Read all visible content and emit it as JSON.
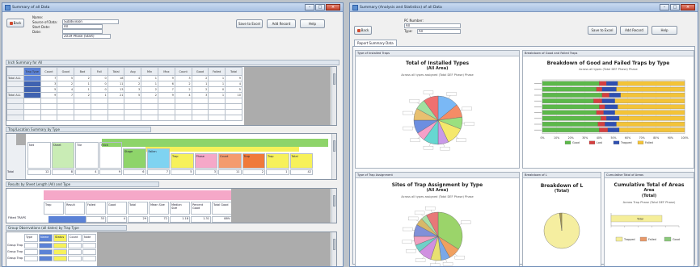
{
  "left_window": {
    "title": "Summary of all Data",
    "buttons": {
      "back": "Back",
      "save_excel": "Save to Excel",
      "add_record": "Add Record",
      "help": "Help"
    },
    "info_labels": {
      "name": "Name:",
      "source": "Source of Data:",
      "start": "Start Date:",
      "date": "Date:"
    },
    "info_values": {
      "name": "Subdivision",
      "source": "All",
      "start": "",
      "date": "2019 Phase (Start)"
    },
    "sections": {
      "s1": "Inch Summary for All",
      "s2": "Trap/Location Summary by Type",
      "s3": "Results by Sheet Length (All) and Type",
      "s4": "Group Observations (all dates) by Trap Type"
    },
    "grid1": {
      "headers": [
        "Trap Type",
        "Count",
        "Good",
        "Bad",
        "Fail",
        "Total",
        "Avg",
        "Min",
        "Max",
        "Count",
        "Good",
        "Failed",
        "Total"
      ],
      "rows": [
        {
          "label": "Total ALL",
          "cells": [
            "",
            "7",
            "5",
            "2",
            "0",
            "18",
            "4",
            "1",
            "9",
            "3",
            "2",
            "1",
            "9"
          ]
        },
        {
          "label": "",
          "cells": [
            "",
            "3",
            "2",
            "1",
            "0",
            "11",
            "2",
            "1",
            "6",
            "2",
            "1",
            "1",
            "4"
          ]
        },
        {
          "label": "",
          "cells": [
            "",
            "5",
            "4",
            "1",
            "0",
            "13",
            "3",
            "2",
            "7",
            "2",
            "2",
            "0",
            "5"
          ]
        },
        {
          "label": "Total ALL",
          "cells": [
            "",
            "9",
            "7",
            "2",
            "1",
            "21",
            "5",
            "2",
            "9",
            "4",
            "3",
            "1",
            "10"
          ]
        }
      ]
    },
    "grid2": {
      "headers": [
        "Net",
        "Sheet",
        "Tile",
        "Thick",
        "Stage",
        "Fallen",
        "Trap",
        "Phase",
        "Count",
        "Trap",
        "Trap",
        "Total"
      ],
      "total_label": "Total",
      "values": [
        "12",
        "8",
        "4",
        "9",
        "6",
        "7",
        "5",
        "3",
        "11",
        "2",
        "1",
        "42"
      ]
    },
    "grid3": {
      "headers": [
        "Trap",
        "Result",
        "Failed",
        "Good",
        "Total",
        "Mean Size",
        "Median Size",
        "Percent Good",
        "Total Good"
      ],
      "row_label": "Fitted TRAPS",
      "values": [
        "33",
        "4",
        "29",
        "72",
        "1.18",
        "1.31",
        "88%",
        "29"
      ]
    },
    "grid4": {
      "headers": [
        "Type",
        "Name",
        "Status",
        "Count",
        "Note"
      ],
      "rows": [
        "Group Trap",
        "Group Trap",
        "Group Trap"
      ]
    }
  },
  "right_window": {
    "title": "Summary (Analysis and Statistics) of all Data",
    "buttons": {
      "back": "Back",
      "save_excel": "Save to Excel",
      "add_record": "Add Record",
      "help": "Help"
    },
    "info_labels": {
      "name": "PC Number:",
      "type": "Type:"
    },
    "info_values": {
      "name": "All",
      "type": "All"
    },
    "tab": "Report Summary Data",
    "panels": {
      "p1": {
        "header": "Type of Installed Traps",
        "title": "Total of Installed Types",
        "subtitle": "(All Area)",
        "note": "Across all types assigned (Total DEF Phase) Phase"
      },
      "p2": {
        "header": "Breakdown of Good and Failed Traps",
        "title": "Breakdown of Good and Failed Traps by Type",
        "subtitle": "Across all types (Total DEF Phase) Phase",
        "legend": [
          "Good",
          "Lost",
          "Trapped",
          "Failed"
        ]
      },
      "p3": {
        "header": "Type of Trap Assignment",
        "title": "Sites of Trap Assignment by Type",
        "subtitle": "(All Area)",
        "note": "Across all types assigned (Total DEF Phase) Phase"
      },
      "p4": {
        "header": "Breakdown of L",
        "title": "Breakdown of L",
        "subtitle": "(Total)"
      },
      "p5": {
        "header": "Cumulative Total of Areas",
        "title": "Cumulative Total of Areas",
        "subtitle": "Area",
        "sub2": "(Total)",
        "note": "Across Trap Phase (Total DEF Phase)",
        "bar_label": "Total",
        "legend": [
          "Trapped",
          "Failed",
          "Good"
        ]
      }
    }
  },
  "chart_data": [
    {
      "type": "pie",
      "title": "Total of Installed Types",
      "subtitle": "(All Area)",
      "values": [
        14,
        9,
        8,
        12,
        7,
        10,
        6,
        9,
        8,
        7,
        10
      ],
      "colors": [
        "#7ab8f5",
        "#f58c66",
        "#9be07f",
        "#f5e86b",
        "#c99ae8",
        "#66d7d1",
        "#f5a0c8",
        "#6c8ee0",
        "#e8c070",
        "#a0e0a0",
        "#f07070"
      ]
    },
    {
      "type": "bar",
      "title": "Breakdown of Good and Failed Traps by Type",
      "categories": [
        "",
        "",
        "",
        "",
        "",
        "",
        "",
        "",
        ""
      ],
      "series": [
        {
          "name": "Good",
          "values": [
            40,
            38,
            42,
            36,
            40,
            38,
            41,
            39,
            40
          ],
          "color": "#5cb84a"
        },
        {
          "name": "Lost",
          "values": [
            5,
            4,
            5,
            6,
            4,
            5,
            4,
            5,
            6
          ],
          "color": "#d43f3f"
        },
        {
          "name": "Trapped",
          "values": [
            8,
            10,
            8,
            9,
            9,
            8,
            9,
            8,
            8
          ],
          "color": "#2f4fb0"
        },
        {
          "name": "Failed",
          "values": [
            47,
            48,
            45,
            49,
            47,
            49,
            46,
            48,
            46
          ],
          "color": "#f3c338"
        }
      ],
      "xlim": [
        0,
        100
      ],
      "xticks": [
        "0%",
        "10%",
        "20%",
        "30%",
        "40%",
        "50%",
        "60%",
        "70%",
        "80%",
        "90%",
        "100%"
      ]
    },
    {
      "type": "pie",
      "title": "Sites of Trap Assignment by Type",
      "subtitle": "(All Area)",
      "values": [
        34,
        8,
        6,
        7,
        9,
        5,
        6,
        8,
        5,
        4,
        8
      ],
      "colors": [
        "#9bd46a",
        "#f0a060",
        "#7aa8e8",
        "#e8e070",
        "#d090e0",
        "#70d0c8",
        "#f0a0c0",
        "#8090d8",
        "#d8b868",
        "#a8e0a8",
        "#e87878"
      ]
    },
    {
      "type": "pie",
      "title": "Breakdown of L",
      "subtitle": "(Total)",
      "values": [
        98,
        2
      ],
      "colors": [
        "#f5eea0",
        "#a89850"
      ]
    },
    {
      "type": "bar",
      "title": "Cumulative Total of Areas",
      "categories": [
        "Total"
      ],
      "values": [
        75
      ],
      "xlim": [
        0,
        100
      ],
      "color": "#f5ee9a"
    }
  ]
}
